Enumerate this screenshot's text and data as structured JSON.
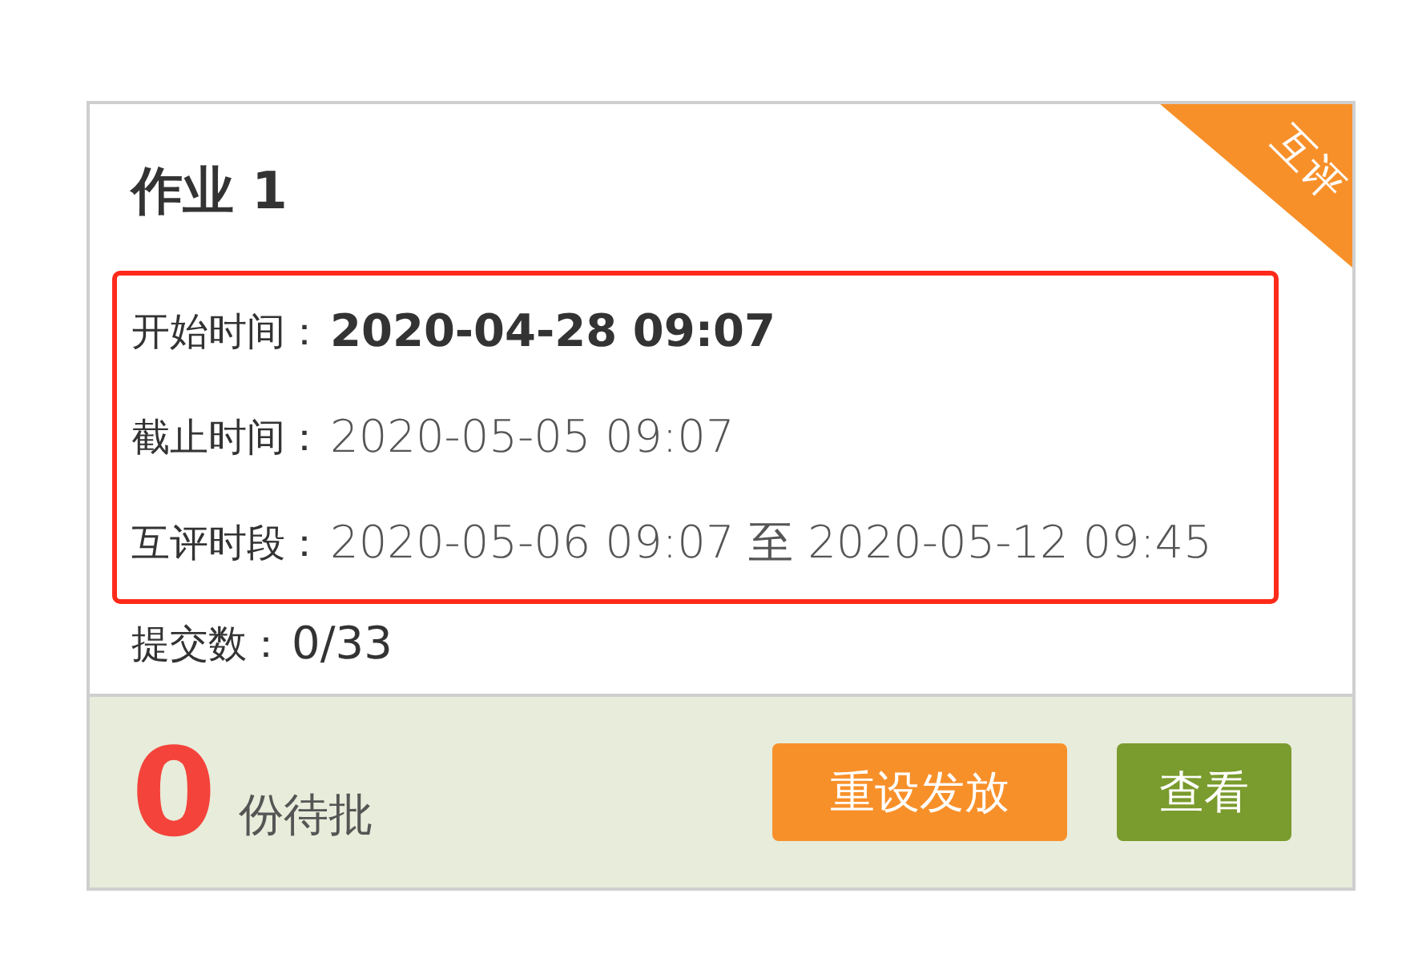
{
  "card": {
    "title": "作业 1",
    "corner_badge": "互评",
    "rows": [
      {
        "label": "开始时间：",
        "value": "2020-04-28 09:07",
        "kind": "strong",
        "highlighted": true
      },
      {
        "label": "截止时间：",
        "value": "2020-05-05 09:07",
        "kind": "light",
        "highlighted": true
      },
      {
        "label": "互评时段：",
        "value": "2020-05-06 09:07 至 2020-05-12 09:45",
        "kind": "light",
        "highlighted": true
      },
      {
        "label": "提交数：",
        "value": "0/33",
        "kind": "normal",
        "highlighted": false
      }
    ],
    "pending": {
      "count": "0",
      "label": "份待批"
    },
    "buttons": [
      {
        "label": "重设发放",
        "kind": "orange"
      },
      {
        "label": "查看",
        "kind": "green"
      }
    ]
  }
}
